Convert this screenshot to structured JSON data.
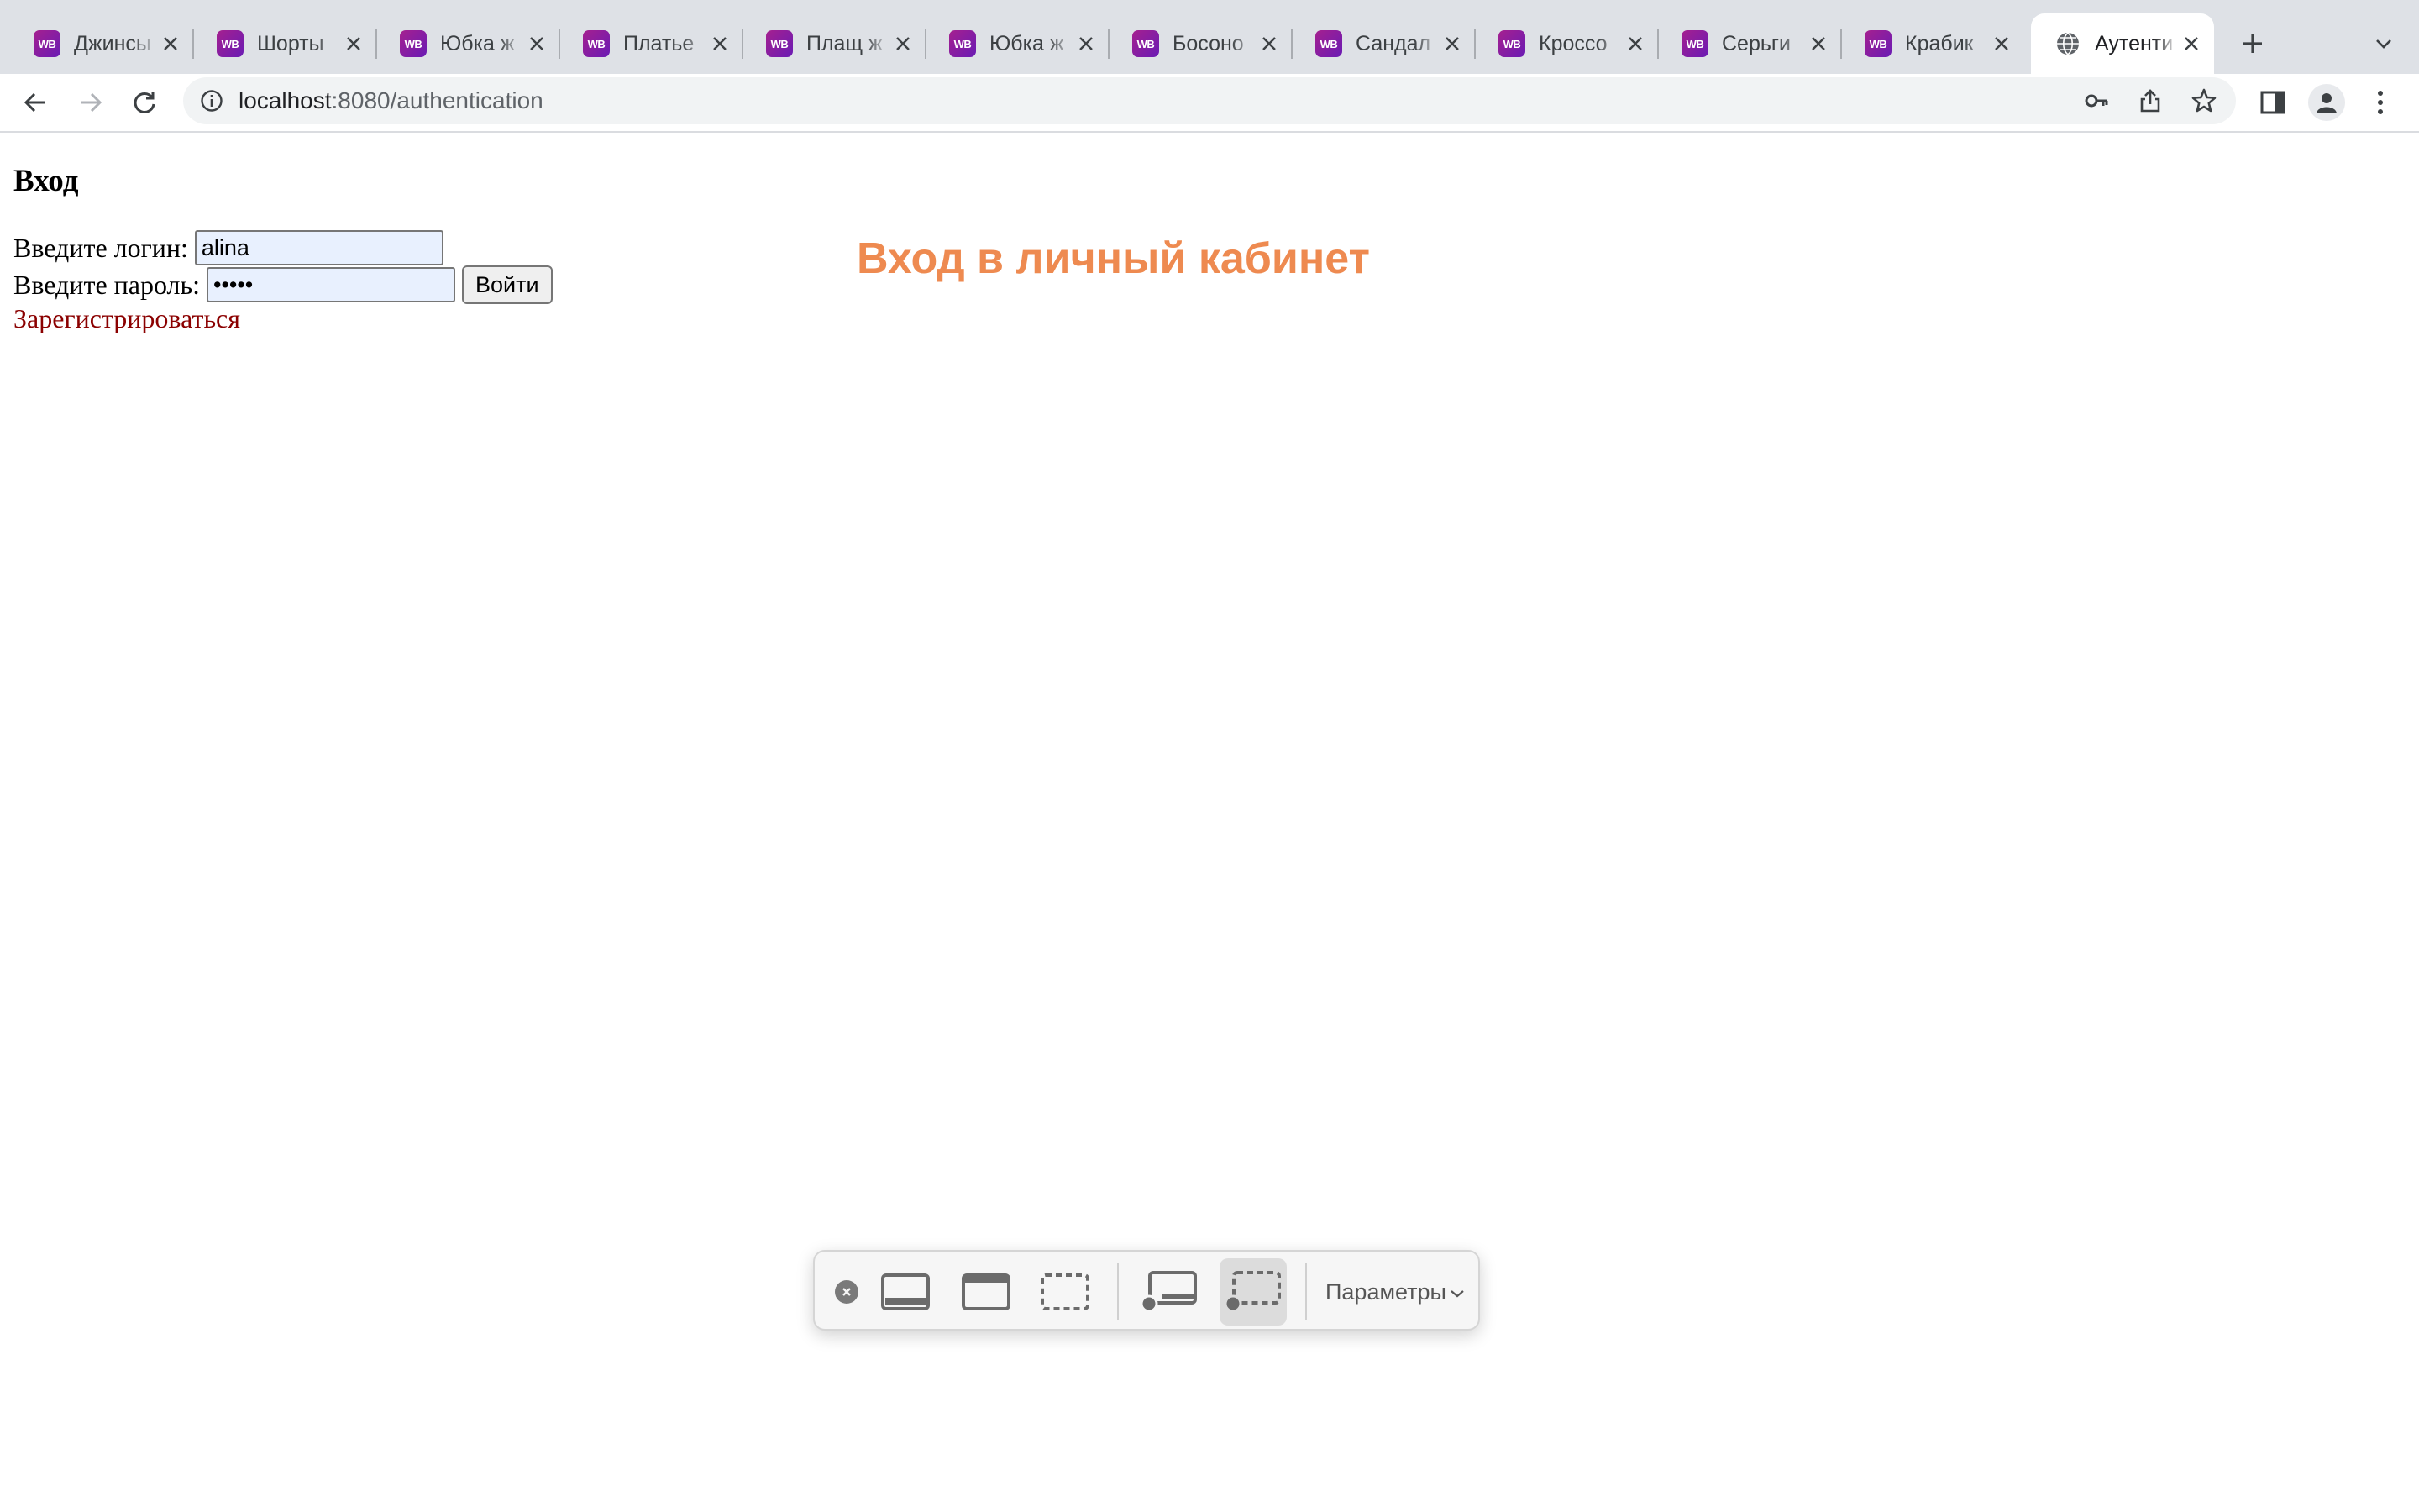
{
  "browser": {
    "tabs": [
      {
        "title": "Джинсы",
        "favicon": "WB",
        "active": false
      },
      {
        "title": "Шорты",
        "favicon": "WB",
        "active": false
      },
      {
        "title": "Юбка ж",
        "favicon": "WB",
        "active": false
      },
      {
        "title": "Платье",
        "favicon": "WB",
        "active": false
      },
      {
        "title": "Плащ ж",
        "favicon": "WB",
        "active": false
      },
      {
        "title": "Юбка ж",
        "favicon": "WB",
        "active": false
      },
      {
        "title": "Босоно",
        "favicon": "WB",
        "active": false
      },
      {
        "title": "Сандал",
        "favicon": "WB",
        "active": false
      },
      {
        "title": "Кроссо",
        "favicon": "WB",
        "active": false
      },
      {
        "title": "Серьги",
        "favicon": "WB",
        "active": false
      },
      {
        "title": "Крабик",
        "favicon": "WB",
        "active": false
      },
      {
        "title": "Аутенти",
        "favicon": "globe",
        "active": true
      }
    ],
    "address": {
      "host": "localhost",
      "path": ":8080/authentication"
    },
    "favicon_colors": {
      "wb_start": "#a5208f",
      "wb_end": "#6a1bb4"
    }
  },
  "page": {
    "heading": "Вход",
    "login_label": "Введите логин:",
    "login_value": "alina",
    "password_label": "Введите пароль:",
    "password_value": "•••••",
    "submit_label": "Войти",
    "register_link": "Зарегистрироваться",
    "headline": "Вход в личный кабинет",
    "headline_color": "#ee8a50",
    "link_color": "#8b0000"
  },
  "screenshot_toolbar": {
    "options_label": "Параметры"
  }
}
